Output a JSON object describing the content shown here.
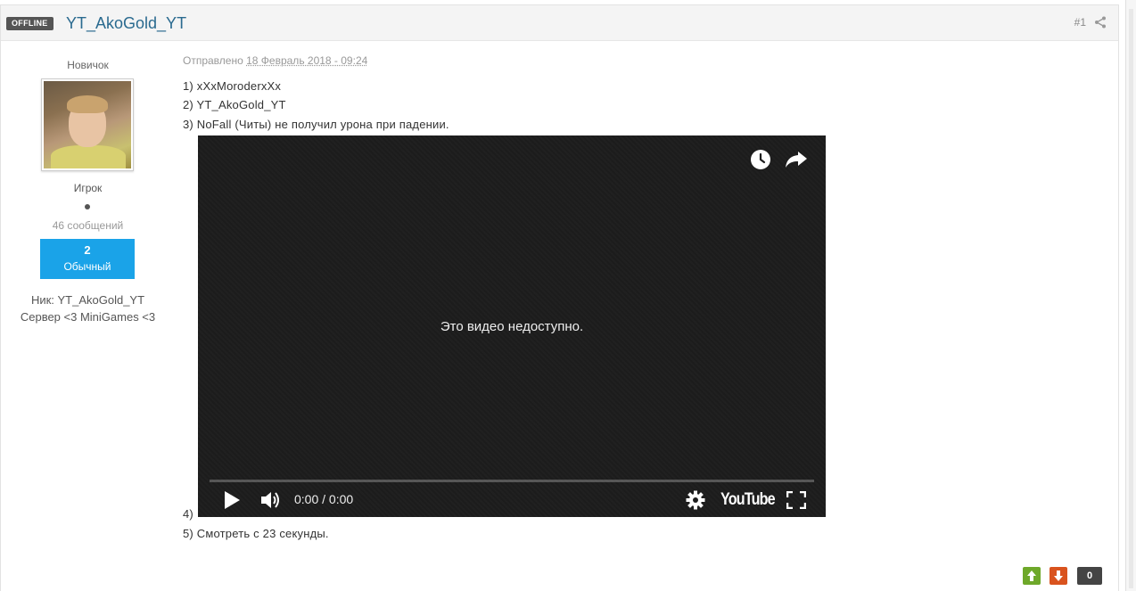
{
  "post": {
    "status_badge": "OFFLINE",
    "author_name": "YT_AkoGold_YT",
    "post_number": "#1",
    "author": {
      "rank_title": "Новичок",
      "group": "Игрок",
      "posts_count": "46 сообщений",
      "reputation_value": "2",
      "reputation_label": "Обычный",
      "nick_field": "Ник: YT_AkoGold_YT",
      "server_field": "Сервер <3 MiniGames <3"
    },
    "posted_prefix": "Отправлено",
    "posted_date": "18 Февраль 2018 - 09:24",
    "lines": [
      "1) xXxMoroderxXx",
      "2) YT_AkoGold_YT",
      "3) NoFall (Читы) не получил урона при падении.",
      "4)",
      "5) Смотреть с 23 секунды."
    ],
    "video": {
      "message": "Это видео недоступно.",
      "time": "0:00 / 0:00",
      "logo": "YouTube"
    },
    "votes": {
      "count": "0"
    }
  },
  "icons": {
    "share": "share-icon",
    "watch_later": "clock-icon",
    "video_share": "share-arrow-icon",
    "play": "play-icon",
    "volume": "volume-icon",
    "settings": "gear-icon",
    "fullscreen": "fullscreen-icon",
    "vote_up": "arrow-up-icon",
    "vote_down": "arrow-down-icon"
  },
  "colors": {
    "author_link": "#2a6a8f",
    "reputation_bg": "#1aa3e8",
    "vote_up": "#6ea82a",
    "vote_down": "#d9531e",
    "badge_bg": "#555555"
  }
}
